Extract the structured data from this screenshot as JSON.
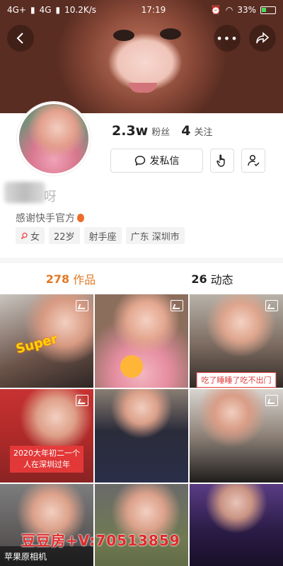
{
  "status_bar": {
    "carrier1": "4G+",
    "carrier2": "4G",
    "speed": "10.2K/s",
    "time": "17:19",
    "battery": "33%"
  },
  "header_icons": {
    "back": "chevron-left-icon",
    "more": "more-dots-icon",
    "share": "share-arrow-icon"
  },
  "profile": {
    "followers_num": "2.3w",
    "followers_label": "粉丝",
    "following_num": "4",
    "following_label": "关注",
    "message_button": "发私信",
    "username_suffix": "呀",
    "bio": "感谢快手官方",
    "tags": [
      "女",
      "22岁",
      "射手座",
      "广东 深圳市"
    ]
  },
  "tabs": [
    {
      "num": "278",
      "label": "作品",
      "active": true
    },
    {
      "num": "26",
      "label": "动态",
      "active": false
    }
  ],
  "grid": {
    "captions": {
      "tile1_sticker": "Super",
      "tile6": "吃了睡睡了吃不出门",
      "tile7": "2020大年初二一个人在深圳过年"
    },
    "overlay_note": "苹果原相机",
    "watermark": "豆豆房+V:70513859"
  },
  "colors": {
    "accent": "#e07a26",
    "caption_red": "#e83a3a",
    "watermark": "#e12a2a"
  }
}
